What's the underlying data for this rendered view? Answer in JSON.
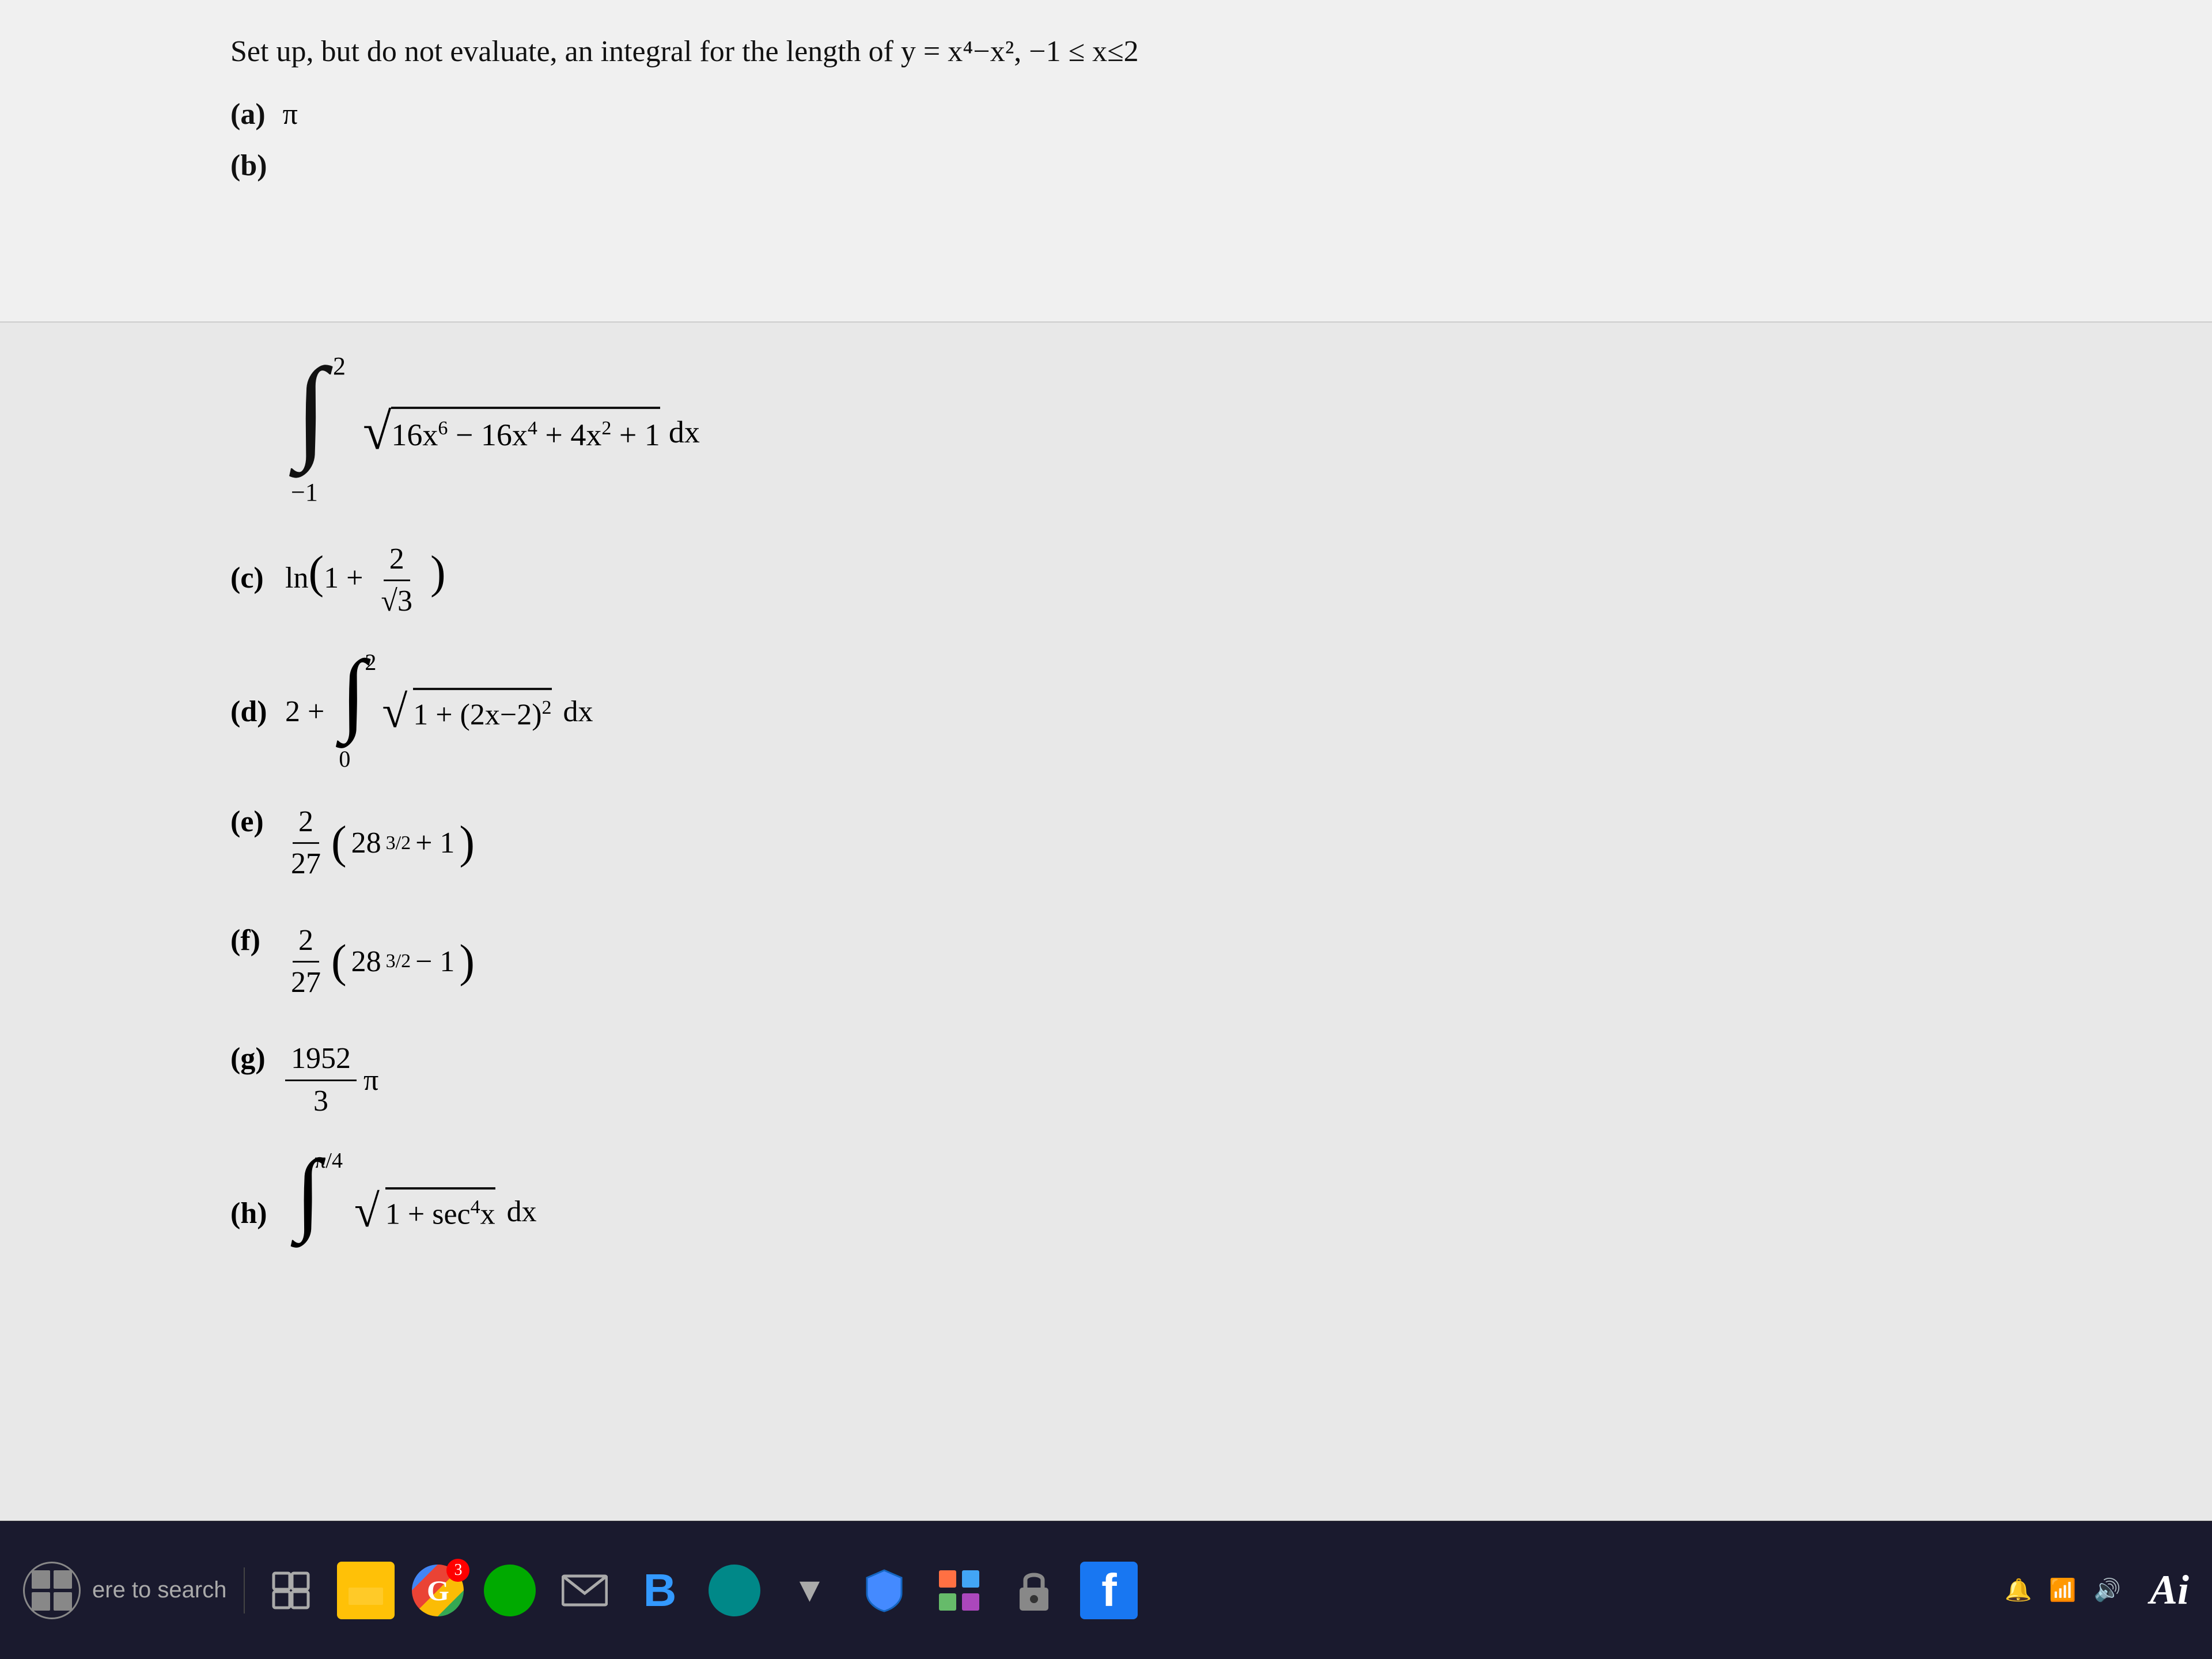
{
  "top": {
    "problem_text": "Set up, but do not evaluate, an integral for the length of y = x⁴−x², −1 ≤ x≤2",
    "part_a_label": "(a)",
    "part_a_answer": "π",
    "part_b_label": "(b)"
  },
  "main": {
    "integral_expr": "∫√(16x⁶ − 16x⁴ + 4x² + 1) dx",
    "integral_upper": "2",
    "integral_lower": "−1",
    "part_c_label": "(c)",
    "part_c_expr": "ln(1 + 2/√3)",
    "part_d_label": "(d)",
    "part_d_expr": "2 + ∫√(1 + (2x−2)²) dx",
    "part_d_upper": "2",
    "part_d_lower": "0",
    "part_e_label": "(e)",
    "part_e_expr": "(2/27)(28^(3/2) + 1)",
    "part_f_label": "(f)",
    "part_f_expr": "(2/27)(28^(3/2) − 1)",
    "part_g_label": "(g)",
    "part_g_expr": "(1952/3)π",
    "part_h_label": "(h)",
    "part_h_expr": "∫√(1 + sec⁴x) dx",
    "part_h_upper": "π/4",
    "part_h_lower": ""
  },
  "taskbar": {
    "search_placeholder": "ere to search",
    "badge_count": "3",
    "ai_label": "Ai"
  }
}
